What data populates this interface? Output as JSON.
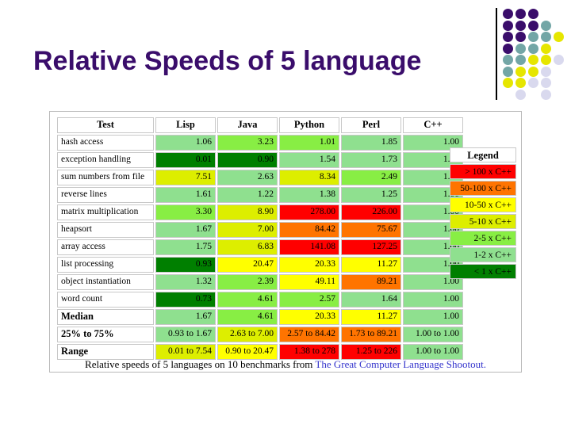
{
  "title": "Relative Speeds of 5 language",
  "caption": {
    "text": "Relative speeds of 5 languages on 10 benchmarks from ",
    "link": "The Great Computer Language Shootout.",
    "link_color": "#3333cc"
  },
  "table": {
    "columns": [
      "Test",
      "Lisp",
      "Java",
      "Python",
      "Perl",
      "C++"
    ],
    "rows": [
      {
        "label": "hash access",
        "summary": false,
        "cells": [
          {
            "value": "1.06",
            "color": "#8fe08f"
          },
          {
            "value": "3.23",
            "color": "#88ee44"
          },
          {
            "value": "1.01",
            "color": "#88ee44"
          },
          {
            "value": "1.85",
            "color": "#8fe08f"
          },
          {
            "value": "1.00",
            "color": "#8fe08f"
          }
        ]
      },
      {
        "label": "exception handling",
        "summary": false,
        "cells": [
          {
            "value": "0.01",
            "color": "#007f00"
          },
          {
            "value": "0.90",
            "color": "#007f00"
          },
          {
            "value": "1.54",
            "color": "#8fe08f"
          },
          {
            "value": "1.73",
            "color": "#8fe08f"
          },
          {
            "value": "1.00",
            "color": "#8fe08f"
          }
        ]
      },
      {
        "label": "sum numbers from file",
        "summary": false,
        "cells": [
          {
            "value": "7.51",
            "color": "#ddee00"
          },
          {
            "value": "2.63",
            "color": "#8fe08f"
          },
          {
            "value": "8.34",
            "color": "#ddee00"
          },
          {
            "value": "2.49",
            "color": "#88ee44"
          },
          {
            "value": "1.00",
            "color": "#8fe08f"
          }
        ]
      },
      {
        "label": "reverse lines",
        "summary": false,
        "cells": [
          {
            "value": "1.61",
            "color": "#8fe08f"
          },
          {
            "value": "1.22",
            "color": "#8fe08f"
          },
          {
            "value": "1.38",
            "color": "#8fe08f"
          },
          {
            "value": "1.25",
            "color": "#8fe08f"
          },
          {
            "value": "1.00",
            "color": "#8fe08f"
          }
        ]
      },
      {
        "label": "matrix multiplication",
        "summary": false,
        "cells": [
          {
            "value": "3.30",
            "color": "#88ee44"
          },
          {
            "value": "8.90",
            "color": "#ddee00"
          },
          {
            "value": "278.00",
            "color": "#ff0000"
          },
          {
            "value": "226.00",
            "color": "#ff0000"
          },
          {
            "value": "1.00",
            "color": "#8fe08f"
          }
        ]
      },
      {
        "label": "heapsort",
        "summary": false,
        "cells": [
          {
            "value": "1.67",
            "color": "#8fe08f"
          },
          {
            "value": "7.00",
            "color": "#ddee00"
          },
          {
            "value": "84.42",
            "color": "#ff7400"
          },
          {
            "value": "75.67",
            "color": "#ff7400"
          },
          {
            "value": "1.00",
            "color": "#8fe08f"
          }
        ]
      },
      {
        "label": "array access",
        "summary": false,
        "cells": [
          {
            "value": "1.75",
            "color": "#8fe08f"
          },
          {
            "value": "6.83",
            "color": "#ddee00"
          },
          {
            "value": "141.08",
            "color": "#ff0000"
          },
          {
            "value": "127.25",
            "color": "#ff0000"
          },
          {
            "value": "1.00",
            "color": "#8fe08f"
          }
        ]
      },
      {
        "label": "list processing",
        "summary": false,
        "cells": [
          {
            "value": "0.93",
            "color": "#007f00"
          },
          {
            "value": "20.47",
            "color": "#ffff00"
          },
          {
            "value": "20.33",
            "color": "#ffff00"
          },
          {
            "value": "11.27",
            "color": "#ffff00"
          },
          {
            "value": "1.00",
            "color": "#8fe08f"
          }
        ]
      },
      {
        "label": "object instantiation",
        "summary": false,
        "cells": [
          {
            "value": "1.32",
            "color": "#8fe08f"
          },
          {
            "value": "2.39",
            "color": "#88ee44"
          },
          {
            "value": "49.11",
            "color": "#ffff00"
          },
          {
            "value": "89.21",
            "color": "#ff7400"
          },
          {
            "value": "1.00",
            "color": "#8fe08f"
          }
        ]
      },
      {
        "label": "word count",
        "summary": false,
        "cells": [
          {
            "value": "0.73",
            "color": "#007f00"
          },
          {
            "value": "4.61",
            "color": "#88ee44"
          },
          {
            "value": "2.57",
            "color": "#88ee44"
          },
          {
            "value": "1.64",
            "color": "#8fe08f"
          },
          {
            "value": "1.00",
            "color": "#8fe08f"
          }
        ]
      },
      {
        "label": "Median",
        "summary": true,
        "cells": [
          {
            "value": "1.67",
            "color": "#8fe08f"
          },
          {
            "value": "4.61",
            "color": "#88ee44"
          },
          {
            "value": "20.33",
            "color": "#ffff00"
          },
          {
            "value": "11.27",
            "color": "#ffff00"
          },
          {
            "value": "1.00",
            "color": "#8fe08f"
          }
        ]
      },
      {
        "label": "25% to 75%",
        "summary": true,
        "cells": [
          {
            "value": "0.93 to 1.67",
            "color": "#8fe08f"
          },
          {
            "value": "2.63 to 7.00",
            "color": "#ddee00"
          },
          {
            "value": "2.57 to 84.42",
            "color": "#ff7400"
          },
          {
            "value": "1.73 to 89.21",
            "color": "#ff7400"
          },
          {
            "value": "1.00 to 1.00",
            "color": "#8fe08f"
          }
        ]
      },
      {
        "label": "Range",
        "summary": true,
        "cells": [
          {
            "value": "0.01 to 7.54",
            "color": "#ddee00"
          },
          {
            "value": "0.90 to 20.47",
            "color": "#ffff00"
          },
          {
            "value": "1.38 to 278",
            "color": "#ff0000"
          },
          {
            "value": "1.25 to 226",
            "color": "#ff0000"
          },
          {
            "value": "1.00 to 1.00",
            "color": "#8fe08f"
          }
        ]
      }
    ]
  },
  "legend": {
    "title": "Legend",
    "entries": [
      {
        "label": "> 100 x C++",
        "color": "#ff0000"
      },
      {
        "label": "50-100 x C++",
        "color": "#ff7400"
      },
      {
        "label": "10-50 x C++",
        "color": "#ffff00"
      },
      {
        "label": "5-10 x C++",
        "color": "#ddee00"
      },
      {
        "label": "2-5 x C++",
        "color": "#88ee44"
      },
      {
        "label": "1-2 x C++",
        "color": "#8fe08f"
      },
      {
        "label": "< 1 x C++",
        "color": "#007f00"
      }
    ]
  },
  "decoration": {
    "colors": {
      "purple": "#3a0d6b",
      "teal": "#73a6a6",
      "yellow": "#e6e600",
      "lavender": "#d9d9ee"
    },
    "dots": [
      {
        "row": 0,
        "col": 0,
        "c": "purple"
      },
      {
        "row": 0,
        "col": 1,
        "c": "purple"
      },
      {
        "row": 0,
        "col": 2,
        "c": "purple"
      },
      {
        "row": 1,
        "col": 0,
        "c": "purple"
      },
      {
        "row": 1,
        "col": 1,
        "c": "purple"
      },
      {
        "row": 1,
        "col": 2,
        "c": "purple"
      },
      {
        "row": 1,
        "col": 3,
        "c": "teal"
      },
      {
        "row": 2,
        "col": 0,
        "c": "purple"
      },
      {
        "row": 2,
        "col": 1,
        "c": "purple"
      },
      {
        "row": 2,
        "col": 2,
        "c": "teal"
      },
      {
        "row": 2,
        "col": 3,
        "c": "teal"
      },
      {
        "row": 2,
        "col": 4,
        "c": "yellow"
      },
      {
        "row": 3,
        "col": 0,
        "c": "purple"
      },
      {
        "row": 3,
        "col": 1,
        "c": "teal"
      },
      {
        "row": 3,
        "col": 2,
        "c": "teal"
      },
      {
        "row": 3,
        "col": 3,
        "c": "yellow"
      },
      {
        "row": 4,
        "col": 0,
        "c": "teal"
      },
      {
        "row": 4,
        "col": 1,
        "c": "teal"
      },
      {
        "row": 4,
        "col": 2,
        "c": "yellow"
      },
      {
        "row": 4,
        "col": 3,
        "c": "yellow"
      },
      {
        "row": 4,
        "col": 4,
        "c": "lavender"
      },
      {
        "row": 5,
        "col": 0,
        "c": "teal"
      },
      {
        "row": 5,
        "col": 1,
        "c": "yellow"
      },
      {
        "row": 5,
        "col": 2,
        "c": "yellow"
      },
      {
        "row": 5,
        "col": 3,
        "c": "lavender"
      },
      {
        "row": 6,
        "col": 0,
        "c": "yellow"
      },
      {
        "row": 6,
        "col": 1,
        "c": "yellow"
      },
      {
        "row": 6,
        "col": 2,
        "c": "lavender"
      },
      {
        "row": 6,
        "col": 3,
        "c": "lavender"
      },
      {
        "row": 7,
        "col": 1,
        "c": "lavender"
      },
      {
        "row": 7,
        "col": 3,
        "c": "lavender"
      }
    ]
  }
}
